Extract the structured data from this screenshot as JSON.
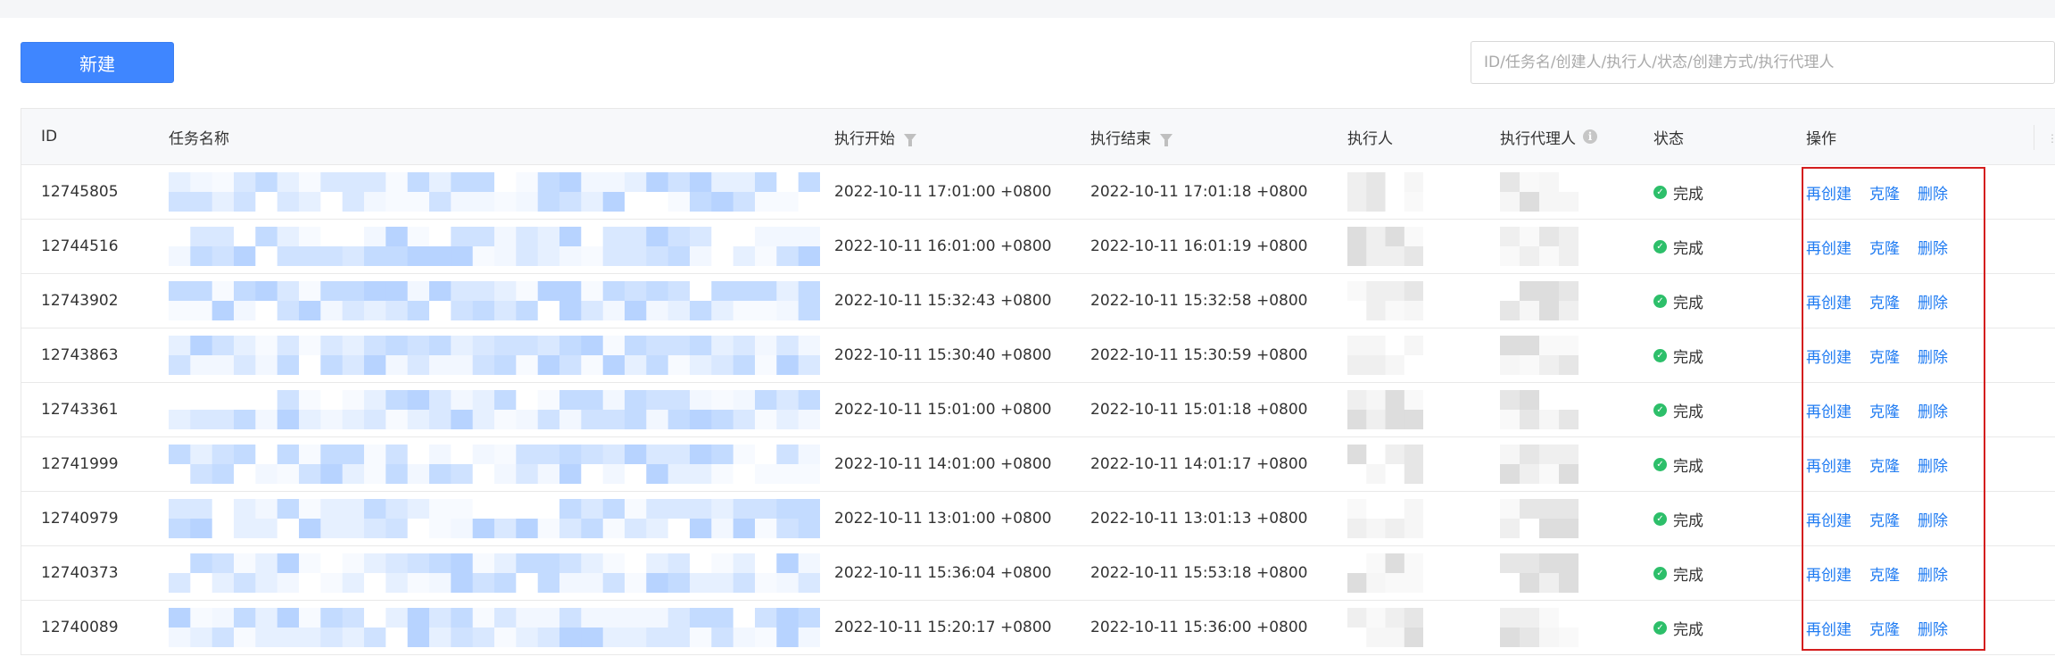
{
  "toolbar": {
    "new_label": "新建",
    "search_placeholder": "ID/任务名/创建人/执行人/状态/创建方式/执行代理人"
  },
  "table": {
    "columns": [
      "ID",
      "任务名称",
      "执行开始",
      "执行结束",
      "执行人",
      "执行代理人",
      "状态",
      "操作"
    ],
    "rows": [
      {
        "id": "12745805",
        "start": "2022-10-11 17:01:00 +0800",
        "end": "2022-10-11 17:01:18 +0800",
        "status": "完成"
      },
      {
        "id": "12744516",
        "start": "2022-10-11 16:01:00 +0800",
        "end": "2022-10-11 16:01:19 +0800",
        "status": "完成"
      },
      {
        "id": "12743902",
        "start": "2022-10-11 15:32:43 +0800",
        "end": "2022-10-11 15:32:58 +0800",
        "status": "完成"
      },
      {
        "id": "12743863",
        "start": "2022-10-11 15:30:40 +0800",
        "end": "2022-10-11 15:30:59 +0800",
        "status": "完成"
      },
      {
        "id": "12743361",
        "start": "2022-10-11 15:01:00 +0800",
        "end": "2022-10-11 15:01:18 +0800",
        "status": "完成"
      },
      {
        "id": "12741999",
        "start": "2022-10-11 14:01:00 +0800",
        "end": "2022-10-11 14:01:17 +0800",
        "status": "完成"
      },
      {
        "id": "12740979",
        "start": "2022-10-11 13:01:00 +0800",
        "end": "2022-10-11 13:01:13 +0800",
        "status": "完成"
      },
      {
        "id": "12740373",
        "start": "2022-10-11 15:36:04 +0800",
        "end": "2022-10-11 15:53:18 +0800",
        "status": "完成"
      },
      {
        "id": "12740089",
        "start": "2022-10-11 15:20:17 +0800",
        "end": "2022-10-11 15:36:00 +0800",
        "status": "完成"
      }
    ],
    "ops": {
      "recreate": "再创建",
      "clone": "克隆",
      "delete": "删除"
    }
  },
  "colors": {
    "primary": "#3f86ff",
    "link": "#1f7bf2",
    "success": "#2dbf6a",
    "highlight": "#d41e1e"
  },
  "icons": [
    "filter-icon",
    "info-icon",
    "check-circle-icon"
  ]
}
